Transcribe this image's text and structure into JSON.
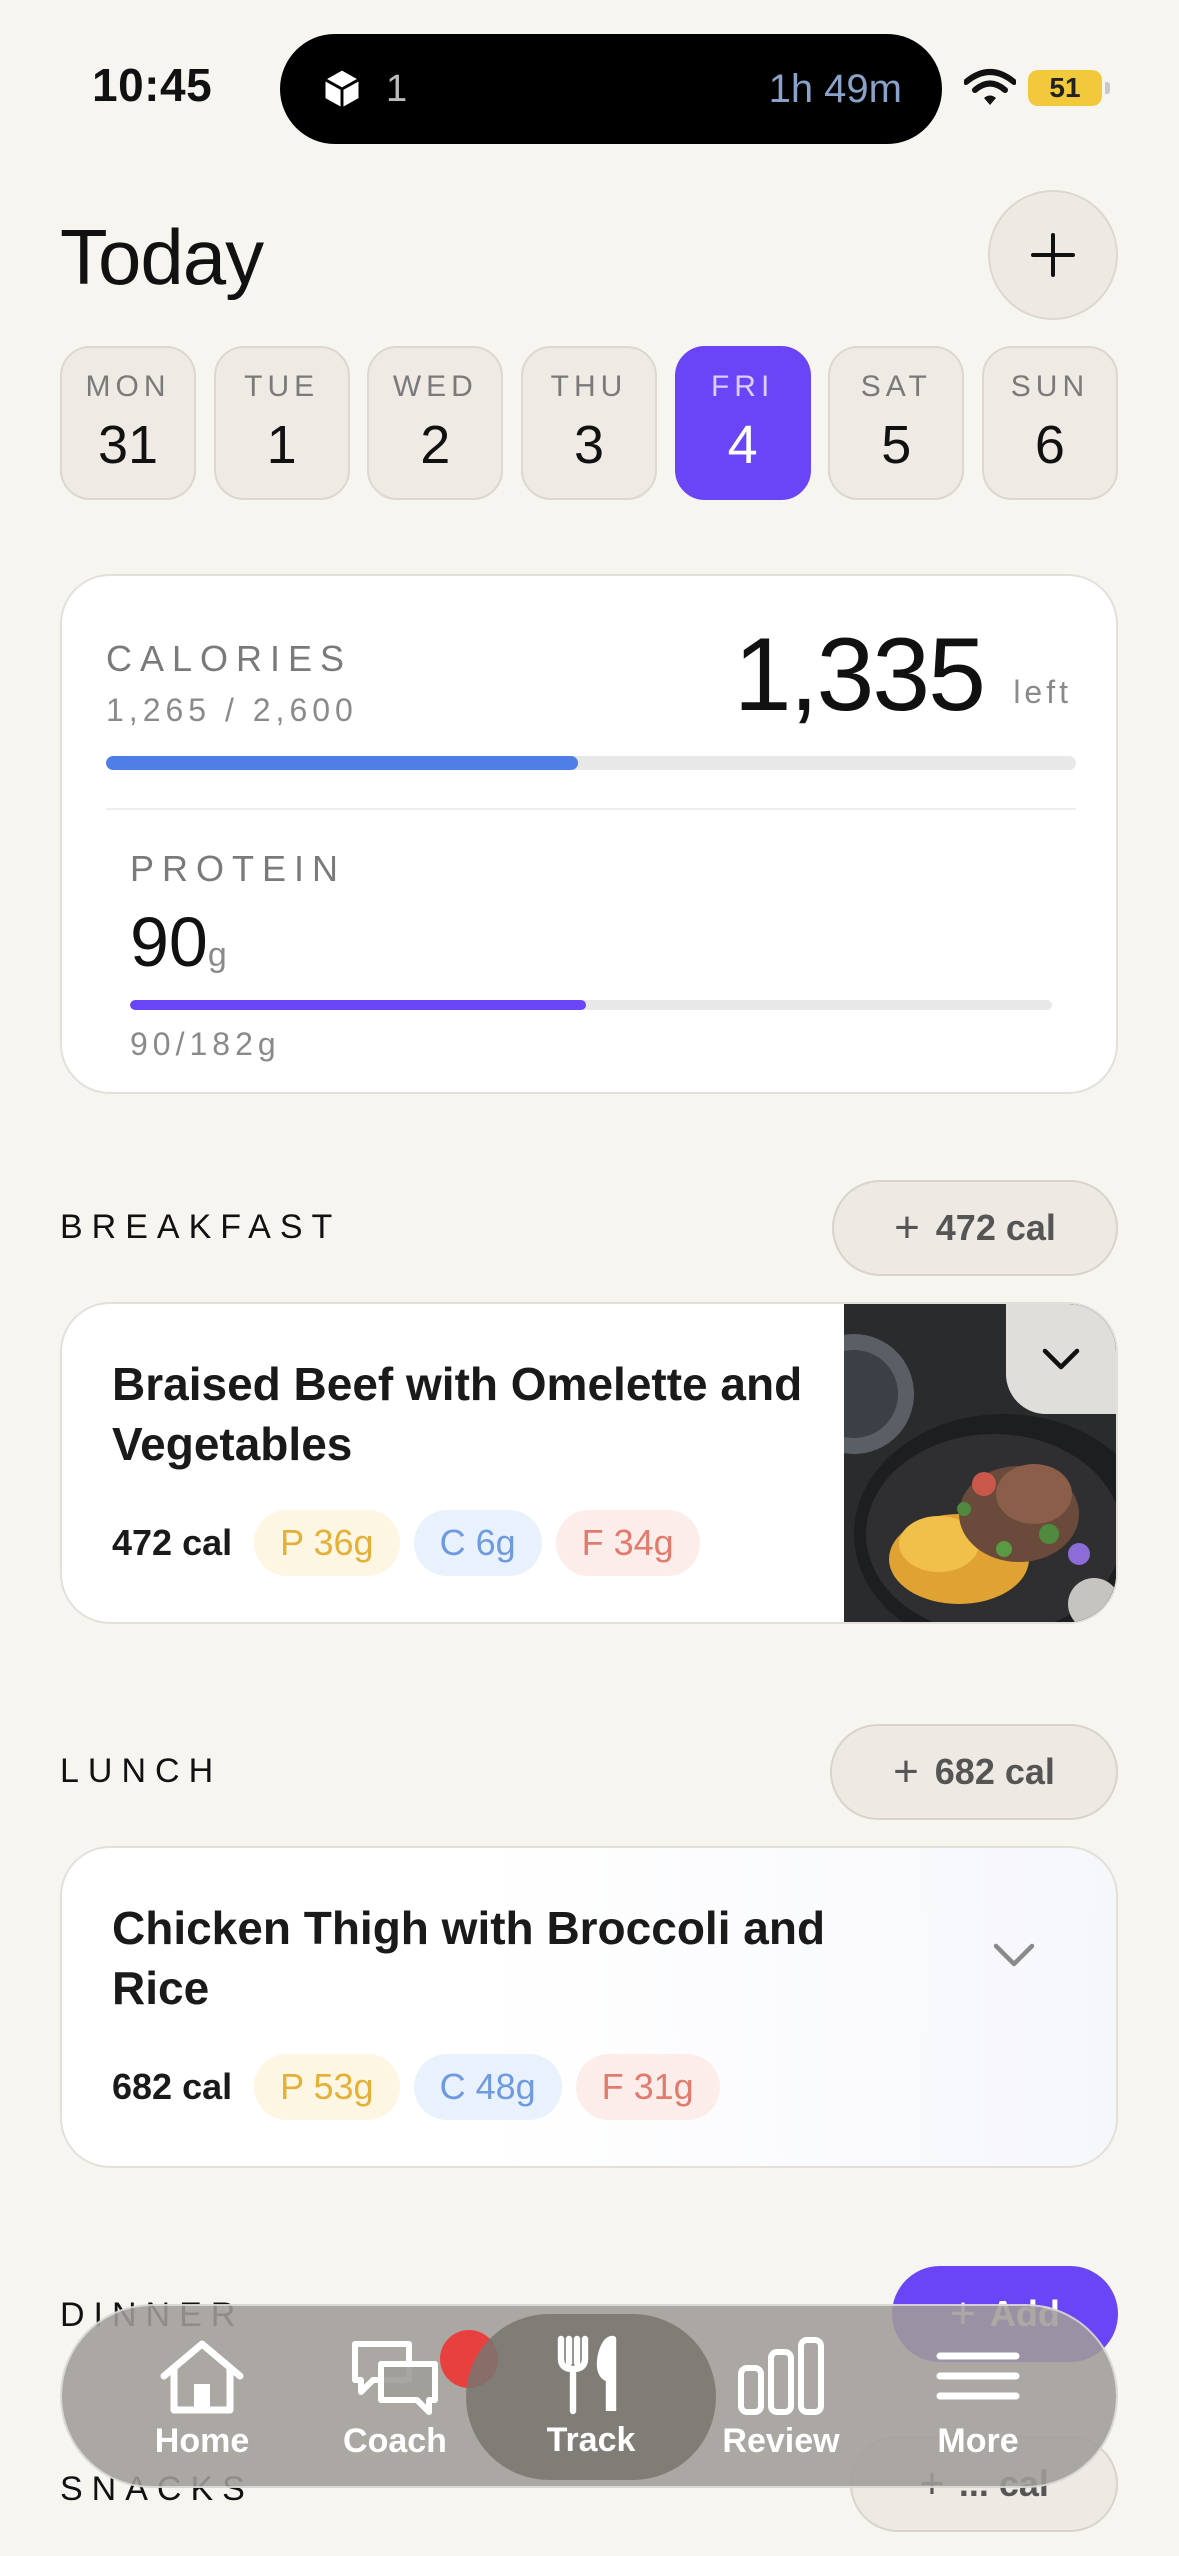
{
  "status_bar": {
    "time": "10:45",
    "activity_count": "1",
    "activity_timer": "1h 49m",
    "battery": "51",
    "battery_color": "#f1c93a"
  },
  "header": {
    "title": "Today",
    "add_icon": "plus-icon"
  },
  "week": [
    {
      "name": "MON",
      "date": "31",
      "selected": false
    },
    {
      "name": "TUE",
      "date": "1",
      "selected": false
    },
    {
      "name": "WED",
      "date": "2",
      "selected": false
    },
    {
      "name": "THU",
      "date": "3",
      "selected": false
    },
    {
      "name": "FRI",
      "date": "4",
      "selected": true
    },
    {
      "name": "SAT",
      "date": "5",
      "selected": false
    },
    {
      "name": "SUN",
      "date": "6",
      "selected": false
    }
  ],
  "calories": {
    "label": "CALORIES",
    "consumed_total": "1,265 / 2,600",
    "remaining": "1,335",
    "remaining_unit": "left",
    "progress_fraction": 0.487,
    "bar_color": "#4e7fe6"
  },
  "protein": {
    "label": "PROTEIN",
    "value": "90",
    "unit": "g",
    "consumed_total": "90/182g",
    "progress_fraction": 0.495,
    "bar_color": "#6a45f5"
  },
  "breakfast": {
    "label": "BREAKFAST",
    "add_label": "472 cal",
    "meal": {
      "name": "Braised Beef with Omelette and Vegetables",
      "calories": "472 cal",
      "protein": "P 36g",
      "carbs": "C 6g",
      "fat": "F 34g"
    }
  },
  "lunch": {
    "label": "LUNCH",
    "add_label": "682 cal",
    "meal": {
      "name": "Chicken Thigh with Broccoli and Rice",
      "calories": "682 cal",
      "protein": "P 53g",
      "carbs": "C 48g",
      "fat": "F 31g"
    }
  },
  "dinner": {
    "label": "DINNER",
    "add_label": "Add"
  },
  "snacks": {
    "label": "SNACKS",
    "add_label": "... cal"
  },
  "tabbar": {
    "tabs": [
      {
        "label": "Home",
        "icon": "home-icon"
      },
      {
        "label": "Coach",
        "icon": "chat-bubbles-icon"
      },
      {
        "label": "Track",
        "icon": "fork-knife-icon"
      },
      {
        "label": "Review",
        "icon": "bar-chart-icon"
      },
      {
        "label": "More",
        "icon": "menu-icon"
      }
    ],
    "active": "Track"
  },
  "accent_color": "#6a45f5"
}
